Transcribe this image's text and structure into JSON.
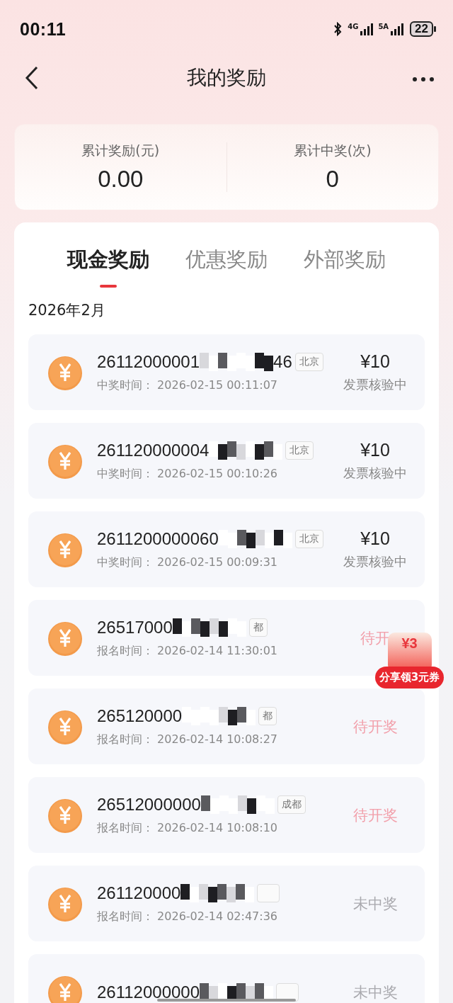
{
  "status_bar": {
    "time": "00:11",
    "network_1": "4G",
    "network_2": "5A",
    "battery": "22"
  },
  "header": {
    "title": "我的奖励"
  },
  "summary": [
    {
      "label": "累计奖励(元)",
      "value": "0.00"
    },
    {
      "label": "累计中奖(次)",
      "value": "0"
    }
  ],
  "tabs": [
    {
      "label": "现金奖励",
      "selected": true
    },
    {
      "label": "优惠奖励",
      "selected": false
    },
    {
      "label": "外部奖励",
      "selected": false
    }
  ],
  "month": "2026年2月",
  "records": [
    {
      "number": "26112000001",
      "suffix": "46",
      "city": "北京",
      "time_label": "中奖时间：",
      "time": "2026-02-15 00:11:07",
      "amount": "¥10",
      "status": "发票核验中",
      "kind": "verifying"
    },
    {
      "number": "261120000004",
      "city": "北京",
      "time_label": "中奖时间：",
      "time": "2026-02-15 00:10:26",
      "amount": "¥10",
      "status": "发票核验中",
      "kind": "verifying"
    },
    {
      "number": "2611200000060",
      "city": "北京",
      "time_label": "中奖时间：",
      "time": "2026-02-15 00:09:31",
      "amount": "¥10",
      "status": "发票核验中",
      "kind": "verifying"
    },
    {
      "number": "26517000",
      "city": "都",
      "time_label": "报名时间：",
      "time": "2026-02-14 11:30:01",
      "status": "待开",
      "kind": "pending"
    },
    {
      "number": "265120000",
      "city": "都",
      "time_label": "报名时间：",
      "time": "2026-02-14 10:08:27",
      "status": "待开奖",
      "kind": "pending"
    },
    {
      "number": "26512000000",
      "city": "成都",
      "time_label": "报名时间：",
      "time": "2026-02-14 10:08:10",
      "status": "待开奖",
      "kind": "pending"
    },
    {
      "number": "261120000",
      "time_label": "报名时间：",
      "time": "2026-02-14 02:47:36",
      "status": "未中奖",
      "kind": "lost"
    },
    {
      "number": "26112000000",
      "status": "未中奖",
      "kind": "lost"
    }
  ],
  "promo": {
    "amount": "¥3",
    "label": "分享领3元券"
  }
}
